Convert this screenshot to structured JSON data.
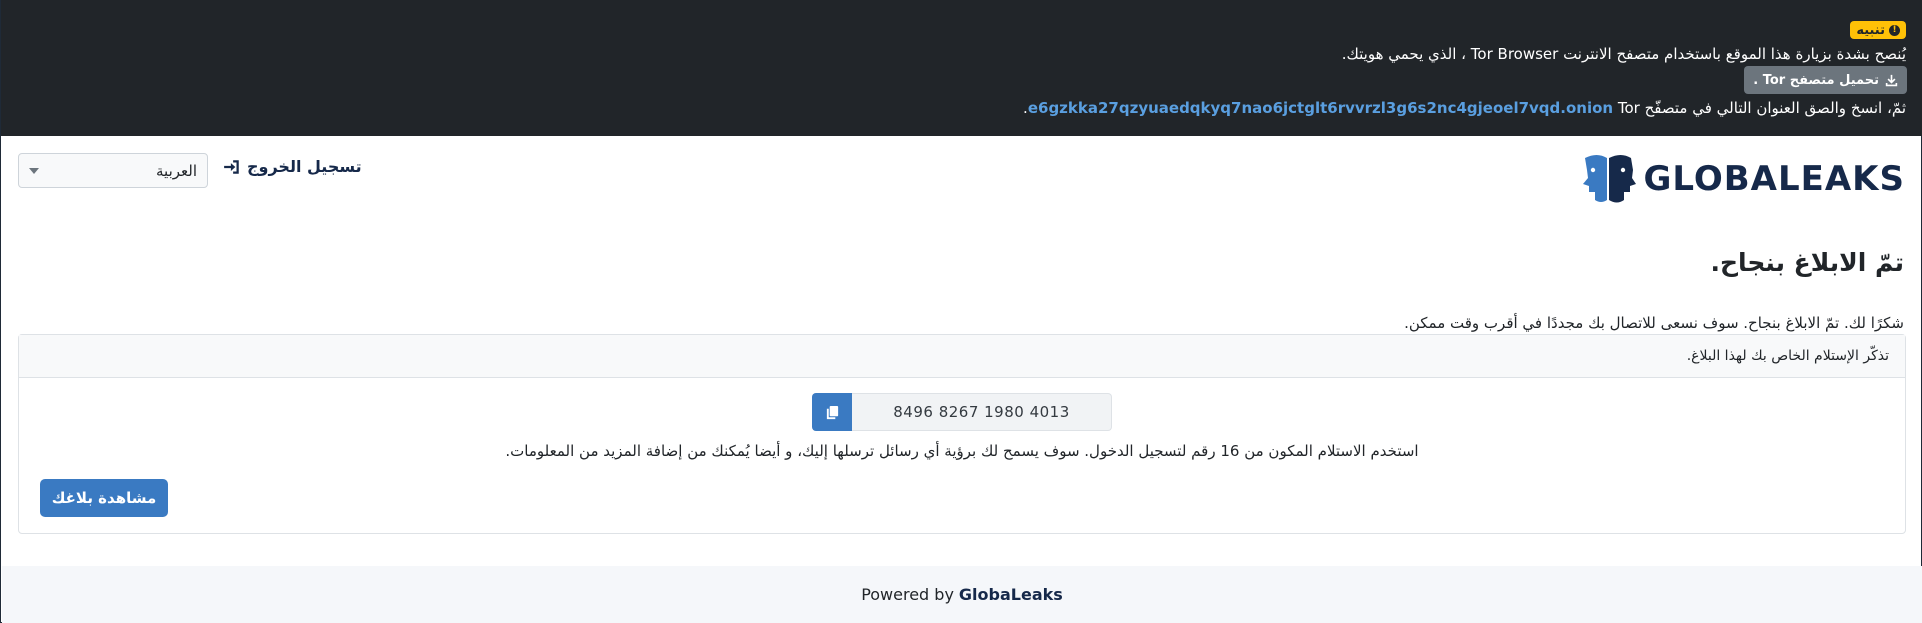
{
  "tor_banner": {
    "badge": "تنبيه",
    "advice": "يُنصح بشدة بزيارة هذا الموقع باستخدام متصفح الانترنت Tor Browser ، الذي يحمي هويتك.",
    "download_label": "تحميل متصفح Tor .",
    "copy_prefix": "ثمّ، انسخ والصق العنوان التالي في متصفّح",
    "onion_address": "e6gzkka27qzyuaedqkyq7nao6jctglt6rvvrzl3g6s2nc4gjeoel7vqd.onion",
    "copy_suffix": "Tor."
  },
  "header": {
    "logo_text": "GLOBALEAKS",
    "logout_label": "تسجيل الخروج",
    "language_selected": "العربية"
  },
  "main": {
    "title": "تمّ الابلاغ بنجاح.",
    "thanks": "شكرًا لك. تمّ الابلاغ بنجاح. سوف نسعى للاتصال بك مجددًا في أقرب وقت ممكن.",
    "card_header": "تذكّر الإستلام الخاص بك لهذا البلاغ.",
    "receipt": "8496 8267 1980 4013",
    "receipt_hint": "استخدم الاستلام المكون من 16 رقم لتسجيل الدخول. سوف يسمح لك برؤية أي رسائل ترسلها إليك، و أيضا يُمكنك من إضافة المزيد من المعلومات.",
    "view_button": "مشاهدة بلاغك"
  },
  "footer": {
    "powered_by": "Powered by",
    "brand": "GlobaLeaks"
  },
  "colors": {
    "banner_bg": "#212529",
    "badge": "#ffc107",
    "primary": "#3a7ac2",
    "brand_navy": "#16294a",
    "onion_link": "#5a9fe0"
  },
  "icons": {
    "badge": "info-circle-icon",
    "download": "download-icon",
    "logout": "sign-out-icon",
    "copy": "copy-icon",
    "select": "chevron-down-icon"
  }
}
